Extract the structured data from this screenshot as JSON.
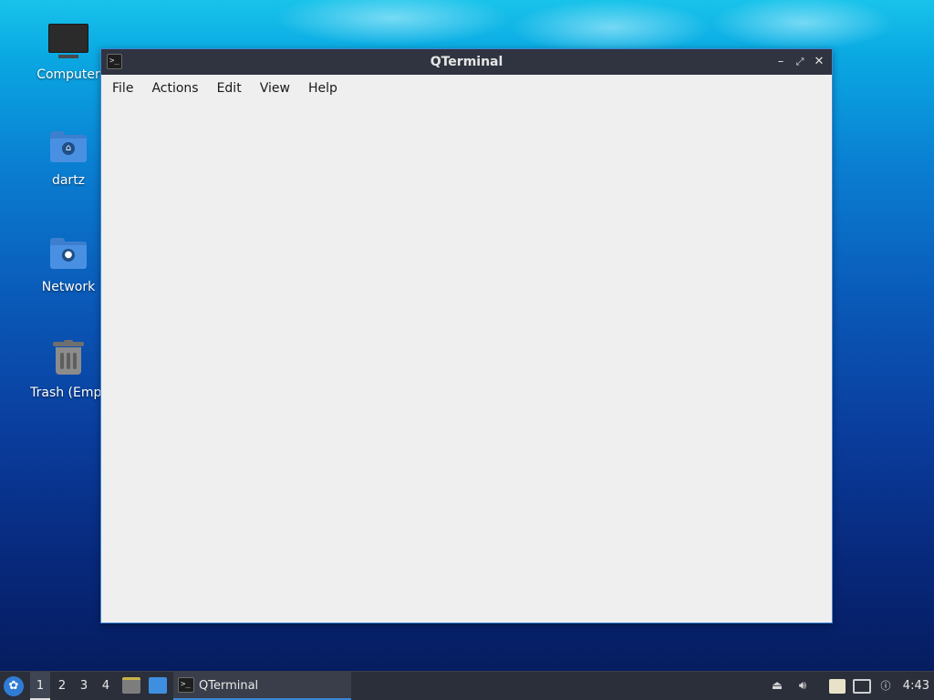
{
  "desktop": {
    "icons": [
      {
        "label": "Computer",
        "icon": "computer-icon"
      },
      {
        "label": "dartz",
        "icon": "home-folder-icon"
      },
      {
        "label": "Network",
        "icon": "network-folder-icon"
      },
      {
        "label": "Trash (Empt",
        "icon": "trash-icon"
      }
    ]
  },
  "window": {
    "title": "QTerminal",
    "app_icon": "terminal-icon",
    "app_icon_glyph": ">_",
    "controls": {
      "minimize": "minimize-icon",
      "maximize": "maximize-icon",
      "close": "close-icon"
    },
    "menu": [
      "File",
      "Actions",
      "Edit",
      "View",
      "Help"
    ]
  },
  "taskbar": {
    "start_icon": "lxqt-start-icon",
    "workspaces": [
      "1",
      "2",
      "3",
      "4"
    ],
    "active_workspace": "1",
    "quick_launch": [
      "file-manager-icon",
      "show-desktop-icon"
    ],
    "task_label": "QTerminal",
    "tray": [
      "eject-icon",
      "volume-icon",
      "clipboard-icon",
      "network-icon",
      "update-notifier-icon"
    ],
    "clock": "4:43"
  },
  "colors": {
    "titlebar": "#2f3440",
    "window_border": "#3c86d6",
    "window_bg": "#efefef",
    "taskbar": "#2b2f3a",
    "accent": "#3c86d6"
  }
}
